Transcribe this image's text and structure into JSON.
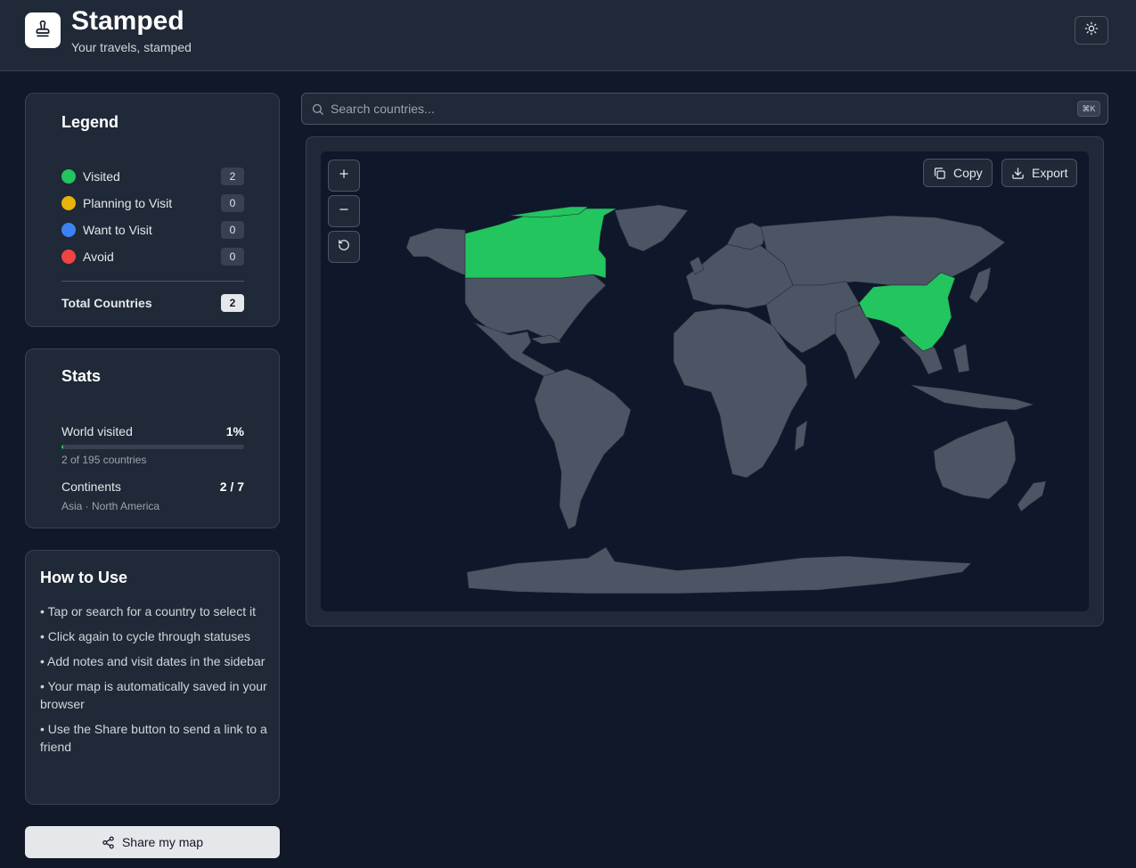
{
  "header": {
    "title": "Stamped",
    "subtitle": "Your travels, stamped",
    "logo_icon": "stamp-icon",
    "theme_icon": "sun-icon"
  },
  "legend": {
    "title": "Legend",
    "items": [
      {
        "label": "Visited",
        "count": "2",
        "color": "#22c55e"
      },
      {
        "label": "Planning to Visit",
        "count": "0",
        "color": "#eab308"
      },
      {
        "label": "Want to Visit",
        "count": "0",
        "color": "#3b82f6"
      },
      {
        "label": "Avoid",
        "count": "0",
        "color": "#ef4444"
      }
    ],
    "total_label": "Total Countries",
    "total_count": "2"
  },
  "stats": {
    "title": "Stats",
    "world_label": "World visited",
    "world_value": "1%",
    "world_progress": 0.01,
    "world_sub": "2 of 195 countries",
    "continents_label": "Continents",
    "continents_value": "2 / 7",
    "continents_sub": "Asia · North America"
  },
  "howto": {
    "title": "How to Use",
    "items": [
      "• Tap or search for a country to select it",
      "• Click again to cycle through statuses",
      "• Add notes and visit dates in the sidebar",
      "• Your map is automatically saved in your browser",
      "• Use the Share button to send a link to a friend"
    ]
  },
  "share_button": "Share my map",
  "search": {
    "placeholder": "Search countries...",
    "shortcut": "⌘K"
  },
  "map": {
    "copy_label": "Copy",
    "export_label": "Export",
    "land_color": "#4b5563",
    "visited_color": "#22c55e",
    "ocean_color": "#0f172a",
    "visited_countries": [
      "Canada",
      "China"
    ]
  }
}
